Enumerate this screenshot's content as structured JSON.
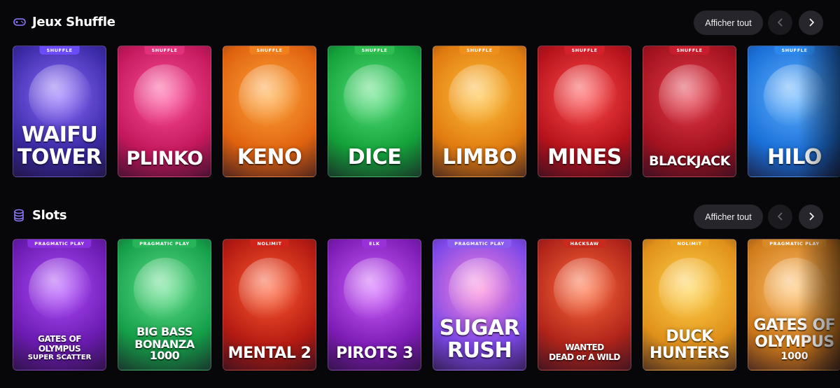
{
  "sections": [
    {
      "title": "Jeux Shuffle",
      "icon": "gamepad-icon",
      "see_all": "Afficher tout",
      "cards": [
        {
          "name": "WAIFU TOWER",
          "line1": "WAIFU",
          "line2": "TOWER",
          "provider": "SHUFFLE",
          "bg": "#3a2aa6",
          "bg2": "#8f6bff",
          "tag": "#6b4cff"
        },
        {
          "name": "PLINKO",
          "line1": "PLINKO",
          "line2": "",
          "provider": "SHUFFLE",
          "bg": "#c2185b",
          "bg2": "#ff4f9a",
          "tag": "#e0307a"
        },
        {
          "name": "KENO",
          "line1": "KENO",
          "line2": "",
          "provider": "SHUFFLE",
          "bg": "#e0620f",
          "bg2": "#ffa63a",
          "tag": "#f07f1c"
        },
        {
          "name": "DICE",
          "line1": "DICE",
          "line2": "",
          "provider": "SHUFFLE",
          "bg": "#14a13a",
          "bg2": "#54e07a",
          "tag": "#2ebd4f"
        },
        {
          "name": "LIMBO",
          "line1": "LIMBO",
          "line2": "",
          "provider": "SHUFFLE",
          "bg": "#e07a10",
          "bg2": "#ffc03a",
          "tag": "#f0901c"
        },
        {
          "name": "MINES",
          "line1": "MINES",
          "line2": "",
          "provider": "SHUFFLE",
          "bg": "#b5121b",
          "bg2": "#ff4a4a",
          "tag": "#d3202b"
        },
        {
          "name": "BLACKJACK",
          "line1": "BLACKJACK",
          "line2": "",
          "provider": "SHUFFLE",
          "bg": "#a3121f",
          "bg2": "#e63a4a",
          "tag": "#c71d2c"
        },
        {
          "name": "HILO",
          "line1": "HILO",
          "line2": "",
          "provider": "SHUFFLE",
          "bg": "#1a6fd8",
          "bg2": "#5fb2ff",
          "tag": "#2a88ee"
        }
      ]
    },
    {
      "title": "Slots",
      "icon": "coins-icon",
      "see_all": "Afficher tout",
      "cards": [
        {
          "name": "GATES OF OLYMPUS SUPER SCATTER",
          "line1": "GATES OF",
          "line2": "OLYMPUS",
          "line3": "SUPER SCATTER",
          "provider": "PRAGMATIC PLAY",
          "bg": "#6a1bb0",
          "bg2": "#b14cff",
          "tag": "#8a2fe0"
        },
        {
          "name": "BIG BASS BONANZA 1000",
          "line1": "BIG BASS",
          "line2": "BONANZA 1000",
          "provider": "PRAGMATIC PLAY",
          "bg": "#159e48",
          "bg2": "#5fe08a",
          "tag": "#28b55a"
        },
        {
          "name": "MENTAL 2",
          "line1": "MENTAL 2",
          "line2": "",
          "provider": "NOLIMIT",
          "bg": "#b31a12",
          "bg2": "#ff5a2e",
          "tag": "#d0241a"
        },
        {
          "name": "PIROTS 3",
          "line1": "PIROTS 3",
          "line2": "",
          "provider": "ELK",
          "bg": "#7d1cb5",
          "bg2": "#d060ff",
          "tag": "#9a30d8"
        },
        {
          "name": "SUGAR RUSH",
          "line1": "SUGAR",
          "line2": "RUSH",
          "provider": "PRAGMATIC PLAY",
          "bg": "#7d48e8",
          "bg2": "#ff86d8",
          "tag": "#8b5cf0"
        },
        {
          "name": "WANTED DEAD OR A WILD",
          "line1": "WANTED",
          "line2": "DEAD or A WILD",
          "provider": "HACKSAW",
          "bg": "#b0241a",
          "bg2": "#ff6a3a",
          "tag": "#c82a1e"
        },
        {
          "name": "DUCK HUNTERS",
          "line1": "DUCK",
          "line2": "HUNTERS",
          "provider": "NOLIMIT",
          "bg": "#e0901a",
          "bg2": "#ffd24a",
          "tag": "#eaa020"
        },
        {
          "name": "GATES OF OLYMPUS 1000",
          "line1": "GATES OF",
          "line2": "OLYMPUS",
          "line3": "1000",
          "provider": "PRAGMATIC PLAY",
          "bg": "#d07a1a",
          "bg2": "#ffc06a",
          "tag": "#d88a28"
        }
      ]
    }
  ]
}
